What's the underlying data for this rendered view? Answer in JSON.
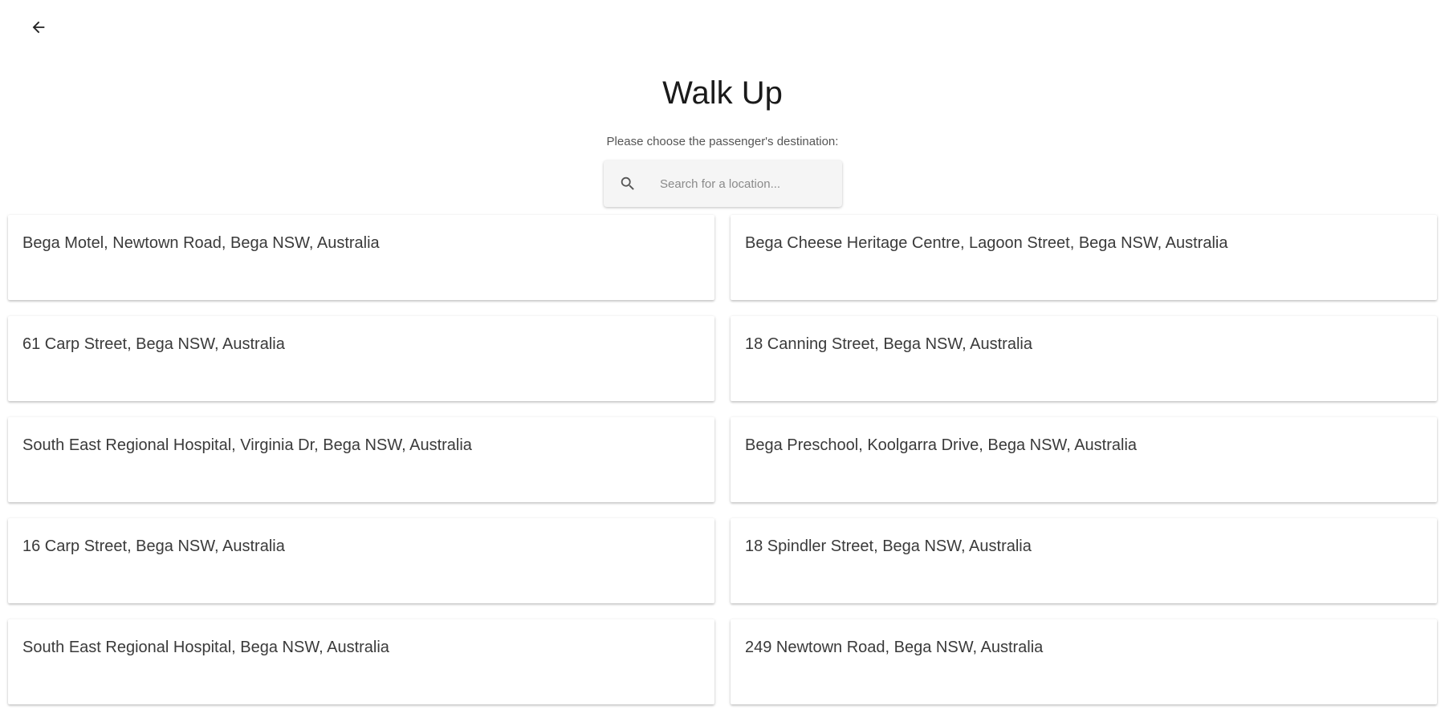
{
  "header": {
    "back_icon": "arrow-left-icon",
    "title": "Walk Up",
    "subtitle": "Please choose the passenger's destination:"
  },
  "search": {
    "icon": "search-icon",
    "placeholder": "Search for a location...",
    "value": ""
  },
  "locations": [
    {
      "label": "Bega Motel, Newtown Road, Bega NSW, Australia"
    },
    {
      "label": "Bega Cheese Heritage Centre, Lagoon Street, Bega NSW, Australia"
    },
    {
      "label": "61 Carp Street, Bega NSW, Australia"
    },
    {
      "label": "18 Canning Street, Bega NSW, Australia"
    },
    {
      "label": "South East Regional Hospital, Virginia Dr, Bega NSW, Australia"
    },
    {
      "label": "Bega Preschool, Koolgarra Drive, Bega NSW, Australia"
    },
    {
      "label": "16 Carp Street, Bega NSW, Australia"
    },
    {
      "label": "18 Spindler Street, Bega NSW, Australia"
    },
    {
      "label": "South East Regional Hospital, Bega NSW, Australia"
    },
    {
      "label": "249 Newtown Road, Bega NSW, Australia"
    }
  ]
}
